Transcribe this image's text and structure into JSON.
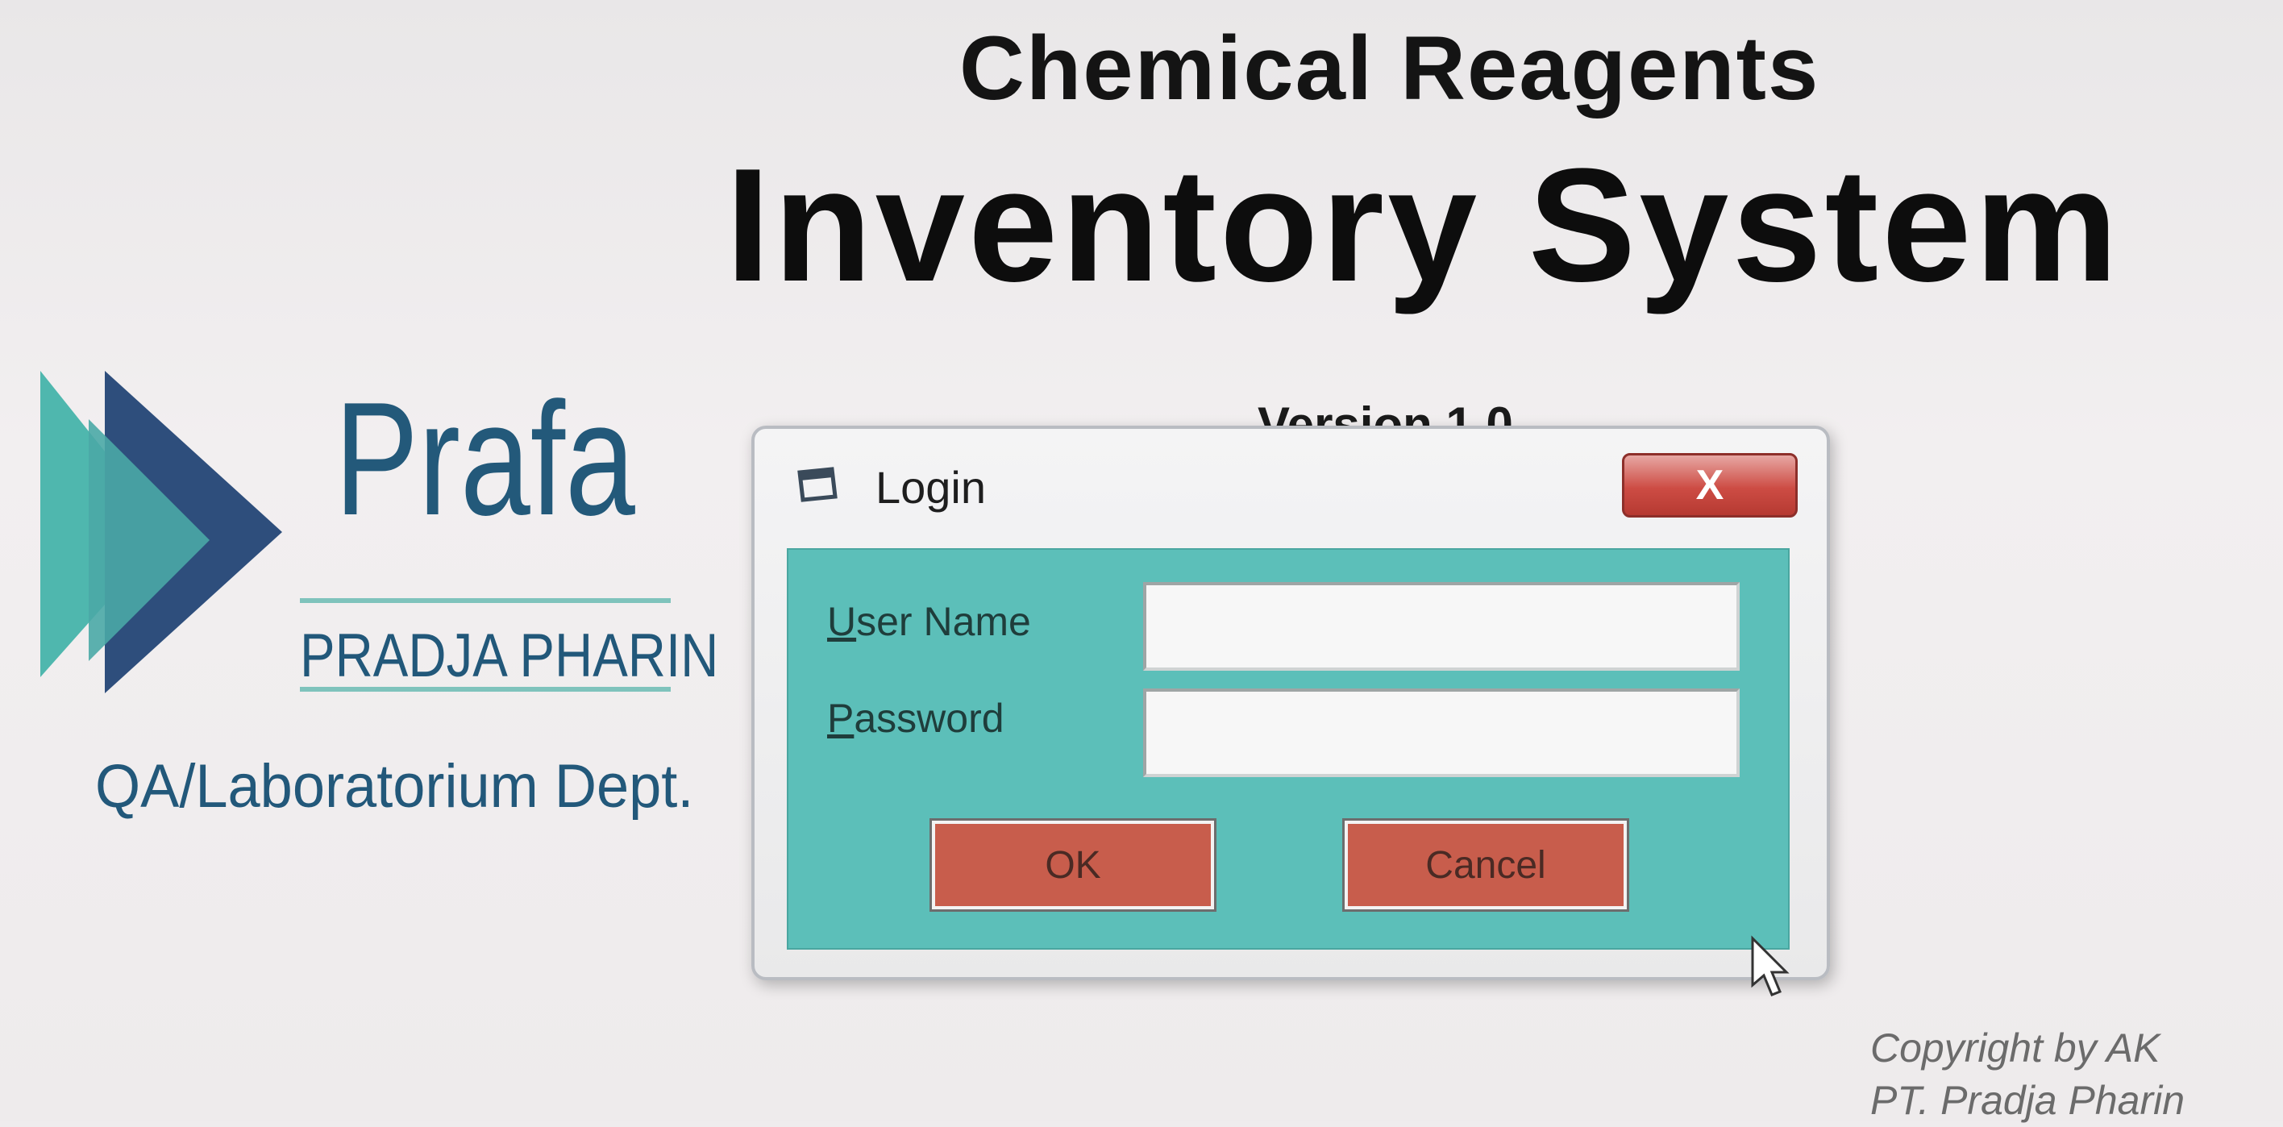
{
  "header": {
    "title_line1": "Chemical Reagents",
    "title_line2": "Inventory System",
    "version": "Version 1.0"
  },
  "branding": {
    "logo_name": "Prafa",
    "company": "PRADJA PHARIN",
    "department": "QA/Laboratorium Dept.",
    "logo_icon": "triple-arrow-icon",
    "colors": {
      "teal": "#5cbfb9",
      "navy": "#23597a"
    }
  },
  "login_dialog": {
    "title": "Login",
    "title_icon": "window-icon",
    "close_label": "X",
    "username_label_accel": "U",
    "username_label_rest": "ser Name",
    "username_value": "",
    "password_label_accel": "P",
    "password_label_rest": "assword",
    "password_value": "",
    "ok_label": "OK",
    "cancel_label": "Cancel",
    "colors": {
      "body": "#5cbfb9",
      "button": "#c85d4c",
      "close": "#cd4c44"
    }
  },
  "footer": {
    "copyright_line1": "Copyright by AK",
    "copyright_line2": "PT. Pradja Pharin"
  }
}
